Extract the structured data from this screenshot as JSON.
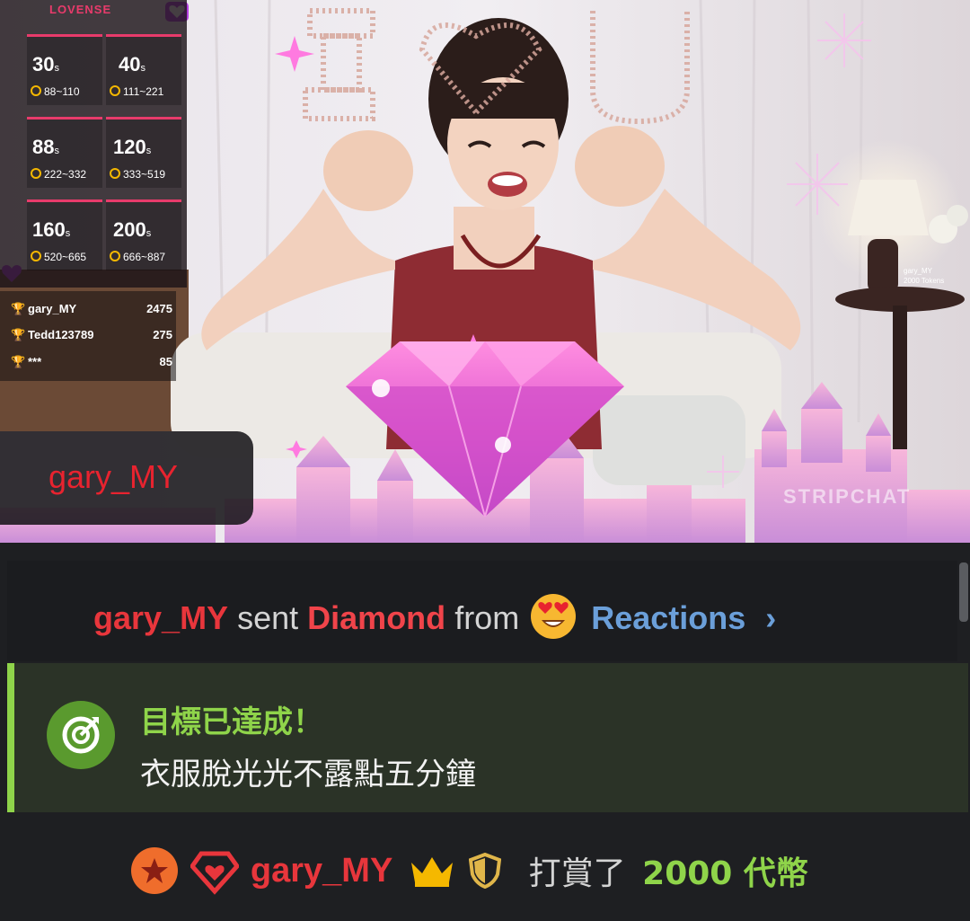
{
  "stream": {
    "lovense_logo": "LOVENSE",
    "tip_menu": [
      {
        "duration": "30",
        "unit": "s",
        "range": "88~110"
      },
      {
        "duration": "40",
        "unit": "s",
        "range": "111~221"
      },
      {
        "duration": "88",
        "unit": "s",
        "range": "222~332"
      },
      {
        "duration": "120",
        "unit": "s",
        "range": "333~519"
      },
      {
        "duration": "160",
        "unit": "s",
        "range": "520~665"
      },
      {
        "duration": "200",
        "unit": "s",
        "range": "666~887"
      }
    ],
    "leaderboard": [
      {
        "name": "gary_MY",
        "points": "2475",
        "trophy": "gold-trophy-icon"
      },
      {
        "name": "Tedd123789",
        "points": "275",
        "trophy": "silver-trophy-icon"
      },
      {
        "name": "***",
        "points": "85",
        "trophy": "bronze-trophy-icon"
      }
    ],
    "gift_popup_name": "gary_MY",
    "lamp_note_user": "gary_MY",
    "lamp_note_tokens": "2000 Tokens",
    "watermark": "STRIPCHAT",
    "overlay_text": "I ♡ U"
  },
  "chat": {
    "gift_message": {
      "user": "gary_MY",
      "sent": "sent",
      "gift": "Diamond",
      "from": "from",
      "emoji": "heart-eyes-emoji-icon",
      "source": "Reactions",
      "chevron": "›"
    },
    "goal_message": {
      "title": "目標已達成！",
      "text": "衣服脫光光不露點五分鐘",
      "icon": "target-icon"
    },
    "tip_message": {
      "user": "gary_MY",
      "verb": "打賞了",
      "amount": "2000 代幣"
    }
  },
  "colors": {
    "username": "#e8363c",
    "goal_green": "#8fd44a",
    "reactions_blue": "#6b9fd9",
    "lovense_pink": "#e83b6b"
  }
}
